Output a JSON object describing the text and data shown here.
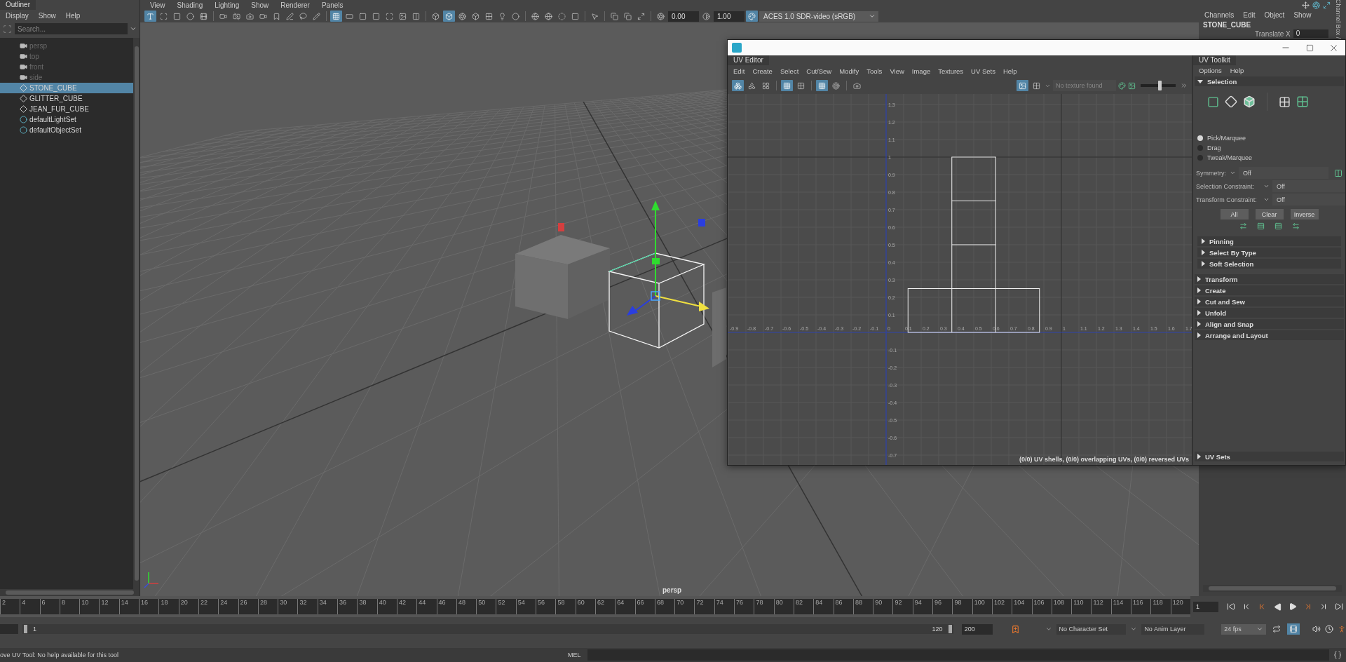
{
  "outliner": {
    "title": "Outliner",
    "menu": [
      "Display",
      "Show",
      "Help"
    ],
    "search": {
      "placeholder": "Search..."
    },
    "items": [
      {
        "label": "persp",
        "kind": "camera",
        "dimmed": true,
        "selected": false
      },
      {
        "label": "top",
        "kind": "camera",
        "dimmed": true,
        "selected": false
      },
      {
        "label": "front",
        "kind": "camera",
        "dimmed": true,
        "selected": false
      },
      {
        "label": "side",
        "kind": "camera",
        "dimmed": true,
        "selected": false
      },
      {
        "label": "STONE_CUBE",
        "kind": "mesh",
        "dimmed": false,
        "selected": true
      },
      {
        "label": "GLITTER_CUBE",
        "kind": "mesh",
        "dimmed": false,
        "selected": false
      },
      {
        "label": "JEAN_FUR_CUBE",
        "kind": "mesh",
        "dimmed": false,
        "selected": false
      },
      {
        "label": "defaultLightSet",
        "kind": "set",
        "dimmed": false,
        "selected": false
      },
      {
        "label": "defaultObjectSet",
        "kind": "set",
        "dimmed": false,
        "selected": false
      }
    ]
  },
  "viewport": {
    "menu": [
      "View",
      "Shading",
      "Lighting",
      "Show",
      "Renderer",
      "Panels"
    ],
    "toolbar": [
      {
        "kind": "text",
        "active": true
      },
      {
        "kind": "marquee",
        "active": false
      },
      {
        "kind": "square",
        "active": false
      },
      {
        "kind": "circle",
        "active": false
      },
      {
        "kind": "film",
        "active": false
      },
      {
        "kind": "sep"
      },
      {
        "kind": "video",
        "active": false
      },
      {
        "kind": "switch-camera",
        "active": false
      },
      {
        "kind": "camera",
        "active": false
      },
      {
        "kind": "video",
        "active": false
      },
      {
        "kind": "bookmark",
        "active": false
      },
      {
        "kind": "pen",
        "active": false
      },
      {
        "kind": "lasso",
        "active": false
      },
      {
        "kind": "pencil",
        "active": false
      },
      {
        "kind": "sep"
      },
      {
        "kind": "grid",
        "active": true
      },
      {
        "kind": "rectangle",
        "active": false
      },
      {
        "kind": "square",
        "active": false
      },
      {
        "kind": "square",
        "active": false
      },
      {
        "kind": "maximize",
        "active": false
      },
      {
        "kind": "image",
        "active": false
      },
      {
        "kind": "columns",
        "active": false
      },
      {
        "kind": "sep"
      },
      {
        "kind": "box",
        "active": false
      },
      {
        "kind": "box",
        "active": true
      },
      {
        "kind": "aperture",
        "active": false
      },
      {
        "kind": "box",
        "active": false
      },
      {
        "kind": "checker",
        "active": false
      },
      {
        "kind": "lightbulb",
        "active": false
      },
      {
        "kind": "circle",
        "active": false
      },
      {
        "kind": "sep"
      },
      {
        "kind": "globe",
        "active": false
      },
      {
        "kind": "globe",
        "active": false
      },
      {
        "kind": "dashed-circle",
        "active": false
      },
      {
        "kind": "square",
        "active": false
      },
      {
        "kind": "sep"
      },
      {
        "kind": "pointer",
        "active": false
      },
      {
        "kind": "sep"
      },
      {
        "kind": "copy",
        "active": false
      },
      {
        "kind": "copy",
        "active": false
      },
      {
        "kind": "expand",
        "active": false
      },
      {
        "kind": "sep"
      },
      {
        "kind": "aperture",
        "active": false
      },
      {
        "kind": "field",
        "value": "0.00"
      },
      {
        "kind": "contrast",
        "active": false
      },
      {
        "kind": "field",
        "value": "1.00"
      },
      {
        "kind": "palette",
        "active": true
      },
      {
        "kind": "dropdown",
        "value": "ACES 1.0 SDR-video (sRGB)"
      }
    ],
    "camera_label": "persp"
  },
  "channel_box": {
    "menu": [
      "Channels",
      "Edit",
      "Object",
      "Show"
    ],
    "object": "STONE_CUBE",
    "attribute": "Translate X",
    "value": "0",
    "side_tab": "Channel Box /"
  },
  "uv_window": {
    "tab": "UV Editor",
    "menu": [
      "Edit",
      "Create",
      "Select",
      "Cut/Sew",
      "Modify",
      "Tools",
      "View",
      "Image",
      "Textures",
      "UV Sets",
      "Help"
    ],
    "toolbar": [
      {
        "kind": "boxes",
        "active": true
      },
      {
        "kind": "shapes",
        "active": false
      },
      {
        "kind": "layout",
        "active": false
      },
      {
        "kind": "sep"
      },
      {
        "kind": "grid",
        "active": true
      },
      {
        "kind": "checker",
        "active": false
      },
      {
        "kind": "sep"
      },
      {
        "kind": "grid-dense",
        "active": true
      },
      {
        "kind": "target",
        "active": false
      },
      {
        "kind": "sep"
      },
      {
        "kind": "camera",
        "active": false
      }
    ],
    "view_toolbar": [
      {
        "kind": "image",
        "active": true
      },
      {
        "kind": "checker",
        "active": false
      }
    ],
    "texture_field": {
      "placeholder": "No texture found"
    },
    "exposure": {
      "level": 0.55
    },
    "x_labels": [
      "-0.9",
      "-0.8",
      "-0.7",
      "-0.6",
      "-0.5",
      "-0.4",
      "-0.3",
      "-0.2",
      "-0.1",
      "0",
      "0.1",
      "0.2",
      "0.3",
      "0.4",
      "0.5",
      "0.6",
      "0.7",
      "0.8",
      "0.9",
      "1",
      "1.1",
      "1.2",
      "1.3",
      "1.4",
      "1.5",
      "1.6",
      "1.7"
    ],
    "y_labels": [
      "1.3",
      "1.2",
      "1.1",
      "1",
      "0.9",
      "0.8",
      "0.7",
      "0.6",
      "0.5",
      "0.4",
      "0.3",
      "0.2",
      "0.1",
      "-0.1",
      "-0.2",
      "-0.3",
      "-0.4",
      "-0.5",
      "-0.6",
      "-0.7"
    ],
    "status": "(0/0) UV shells, (0/0) overlapping UVs, (0/0) reversed UVs",
    "toolkit": {
      "tab": "UV Toolkit",
      "menu": [
        "Options",
        "Help"
      ],
      "selection": {
        "title": "Selection",
        "expanded": true,
        "modes": [
          {
            "label": "Pick/Marquee",
            "selected": true
          },
          {
            "label": "Drag",
            "selected": false
          },
          {
            "label": "Tweak/Marquee",
            "selected": false
          }
        ],
        "symmetry": {
          "label": "Symmetry:",
          "value": "Off"
        },
        "constraints": [
          {
            "label": "Selection Constraint:",
            "value": "Off"
          },
          {
            "label": "Transform Constraint:",
            "value": "Off"
          }
        ],
        "buttons": [
          "All",
          "Clear",
          "Inverse"
        ],
        "subsections": [
          {
            "title": "Pinning",
            "expanded": false
          },
          {
            "title": "Select By Type",
            "expanded": false
          },
          {
            "title": "Soft Selection",
            "expanded": false
          }
        ]
      },
      "sections": [
        {
          "title": "Transform",
          "expanded": false
        },
        {
          "title": "Create",
          "expanded": false
        },
        {
          "title": "Cut and Sew",
          "expanded": false
        },
        {
          "title": "Unfold",
          "expanded": false
        },
        {
          "title": "Align and Snap",
          "expanded": false
        },
        {
          "title": "Arrange and Layout",
          "expanded": false
        }
      ],
      "footer_section": {
        "title": "UV Sets",
        "expanded": false
      }
    }
  },
  "timeline": {
    "ticks": [
      "2",
      "4",
      "6",
      "8",
      "10",
      "12",
      "14",
      "16",
      "18",
      "20",
      "22",
      "24",
      "26",
      "28",
      "30",
      "32",
      "34",
      "36",
      "38",
      "40",
      "42",
      "44",
      "46",
      "48",
      "50",
      "52",
      "54",
      "56",
      "58",
      "60",
      "62",
      "64",
      "66",
      "68",
      "70",
      "72",
      "74",
      "76",
      "78",
      "80",
      "82",
      "84",
      "86",
      "88",
      "90",
      "92",
      "94",
      "96",
      "98",
      "100",
      "102",
      "104",
      "106",
      "108",
      "110",
      "112",
      "114",
      "116",
      "118",
      "120"
    ],
    "current_frame": "1"
  },
  "range": {
    "start": "1",
    "end": "120",
    "max": "200",
    "character_set": "No Character Set",
    "anim_layer": "No Anim Layer",
    "fps": "24 fps",
    "level": 1,
    "options": [
      {
        "kind": "loop",
        "active": false
      },
      {
        "kind": "cache",
        "active": true
      }
    ]
  },
  "status": {
    "help": "ove UV Tool: No help available for this tool",
    "language": "MEL"
  }
}
